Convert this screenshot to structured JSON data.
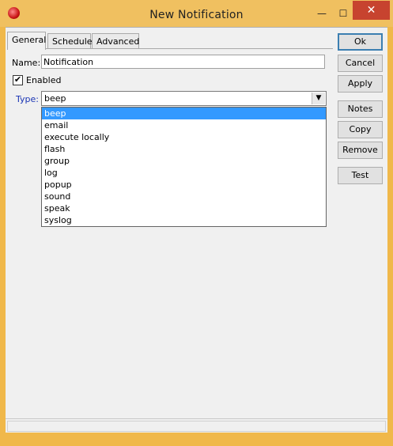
{
  "window": {
    "title": "New Notification",
    "minimize_glyph": "—",
    "maximize_glyph": "☐",
    "close_glyph": "✕"
  },
  "tabs": [
    {
      "label": "General",
      "active": true
    },
    {
      "label": "Schedule",
      "active": false
    },
    {
      "label": "Advanced",
      "active": false
    }
  ],
  "form": {
    "name_label": "Name:",
    "name_value": "Notification",
    "enabled_label": "Enabled",
    "enabled_checked": true,
    "check_glyph": "✔",
    "type_label": "Type:",
    "type_value": "beep",
    "dropdown_arrow": "▼"
  },
  "type_options": [
    "beep",
    "email",
    "execute locally",
    "flash",
    "group",
    "log",
    "popup",
    "sound",
    "speak",
    "syslog"
  ],
  "buttons": {
    "ok": "Ok",
    "cancel": "Cancel",
    "apply": "Apply",
    "notes": "Notes",
    "copy": "Copy",
    "remove": "Remove",
    "test": "Test"
  },
  "colors": {
    "title_bar": "#f0c060",
    "close_button": "#c7432f",
    "selection": "#3399ff",
    "type_label": "#1a35b5"
  }
}
